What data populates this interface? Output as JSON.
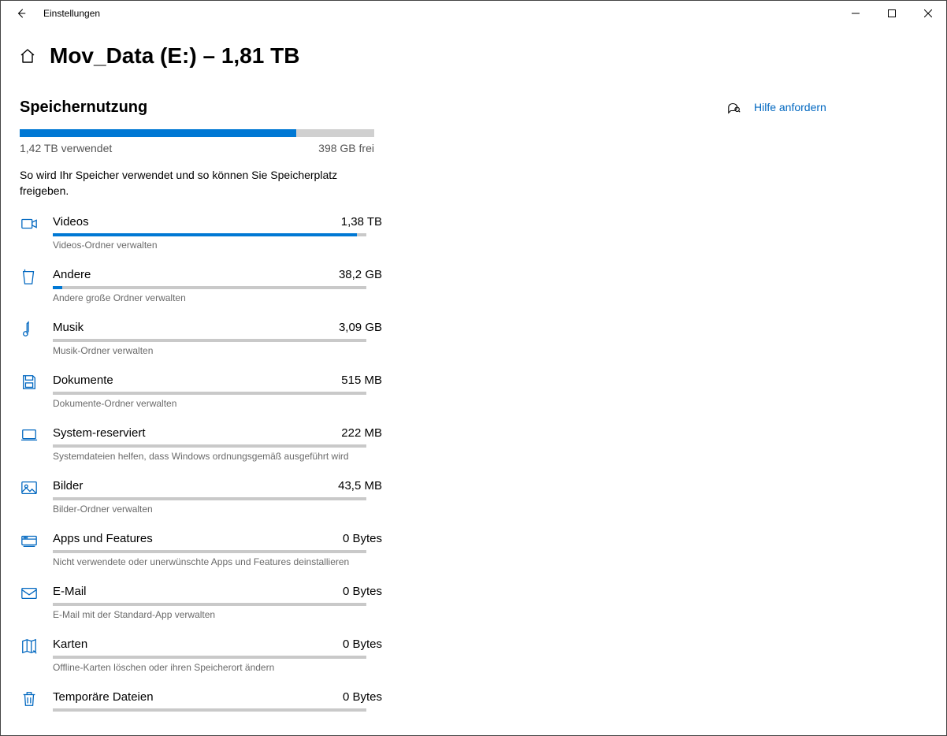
{
  "window": {
    "title": "Einstellungen"
  },
  "header": {
    "page_title": "Mov_Data (E:) – 1,81 TB"
  },
  "help": {
    "label": "Hilfe anfordern"
  },
  "storage": {
    "section_title": "Speichernutzung",
    "used_label": "1,42 TB verwendet",
    "free_label": "398 GB frei",
    "used_pct": 78,
    "desc": "So wird Ihr Speicher verwendet und so können Sie Speicherplatz freigeben."
  },
  "categories": [
    {
      "icon": "video",
      "name": "Videos",
      "size": "1,38 TB",
      "pct": 97,
      "sub": "Videos-Ordner verwalten"
    },
    {
      "icon": "other",
      "name": "Andere",
      "size": "38,2 GB",
      "pct": 3,
      "sub": "Andere große Ordner verwalten"
    },
    {
      "icon": "music",
      "name": "Musik",
      "size": "3,09 GB",
      "pct": 0,
      "sub": "Musik-Ordner verwalten"
    },
    {
      "icon": "docs",
      "name": "Dokumente",
      "size": "515 MB",
      "pct": 0,
      "sub": "Dokumente-Ordner verwalten"
    },
    {
      "icon": "system",
      "name": "System-reserviert",
      "size": "222 MB",
      "pct": 0,
      "sub": "Systemdateien helfen, dass Windows ordnungsgemäß ausgeführt wird"
    },
    {
      "icon": "pictures",
      "name": "Bilder",
      "size": "43,5 MB",
      "pct": 0,
      "sub": "Bilder-Ordner verwalten"
    },
    {
      "icon": "apps",
      "name": "Apps und Features",
      "size": "0 Bytes",
      "pct": 0,
      "sub": "Nicht verwendete oder unerwünschte Apps und Features deinstallieren"
    },
    {
      "icon": "mail",
      "name": "E-Mail",
      "size": "0 Bytes",
      "pct": 0,
      "sub": "E-Mail mit der Standard-App verwalten"
    },
    {
      "icon": "maps",
      "name": "Karten",
      "size": "0 Bytes",
      "pct": 0,
      "sub": "Offline-Karten löschen oder ihren Speicherort ändern"
    },
    {
      "icon": "temp",
      "name": "Temporäre Dateien",
      "size": "0 Bytes",
      "pct": 0,
      "sub": ""
    }
  ],
  "icons": {
    "video": "video-icon",
    "other": "folder-icon",
    "music": "music-icon",
    "docs": "save-icon",
    "system": "laptop-icon",
    "pictures": "picture-icon",
    "apps": "apps-icon",
    "mail": "mail-icon",
    "maps": "map-icon",
    "temp": "trash-icon"
  }
}
